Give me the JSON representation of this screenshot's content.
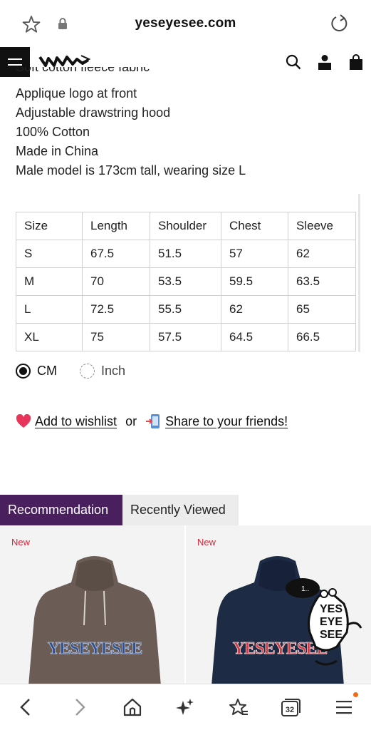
{
  "browser": {
    "url": "yeseyesee.com",
    "tab_count": "32"
  },
  "site": {
    "brand_logo_text": "YESEYESEE"
  },
  "description": {
    "partial_line": "Soft cotton fleece fabric",
    "lines": [
      "Applique logo at front",
      "Adjustable drawstring hood",
      "100% Cotton",
      "Made in China",
      "Male model is 173cm tall, wearing size L"
    ]
  },
  "size_table": {
    "headers": [
      "Size",
      "Length",
      "Shoulder",
      "Chest",
      "Sleeve"
    ],
    "rows": [
      [
        "S",
        "67.5",
        "51.5",
        "57",
        "62"
      ],
      [
        "M",
        "70",
        "53.5",
        "59.5",
        "63.5"
      ],
      [
        "L",
        "72.5",
        "55.5",
        "62",
        "65"
      ],
      [
        "XL",
        "75",
        "57.5",
        "64.5",
        "66.5"
      ]
    ]
  },
  "units": {
    "options": [
      "CM",
      "Inch"
    ],
    "selected": "CM"
  },
  "actions": {
    "wishlist_label": "Add to wishlist",
    "or_label": "or",
    "share_label": "Share to your friends!"
  },
  "tabs": [
    {
      "label": "Recommendation",
      "active": true
    },
    {
      "label": "Recently Viewed",
      "active": false
    }
  ],
  "products": [
    {
      "badge": "New",
      "print": "YESEYESEE",
      "color": "#6b5d55"
    },
    {
      "badge": "New",
      "print": "YESEYESEE",
      "color": "#1e2b45"
    }
  ],
  "colors": {
    "accent_tab": "#4a1f5e",
    "badge_new": "#d0263b",
    "notification_dot": "#f26b1d"
  }
}
